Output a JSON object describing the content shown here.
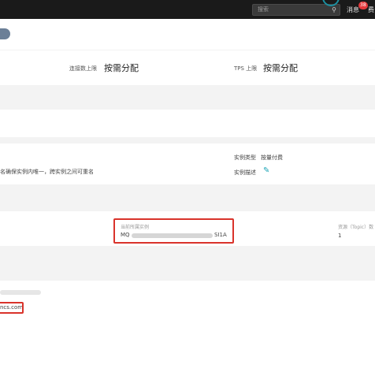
{
  "topbar": {
    "search_placeholder": "搜索",
    "search_icon": "search-icon",
    "messages_label": "消息",
    "messages_badge": "38",
    "more_label": "费"
  },
  "capacity": {
    "connection_label": "连接数上限",
    "connection_value": "按需分配",
    "tps_label": "TPS 上限",
    "tps_value": "按需分配"
  },
  "instance": {
    "type_label": "实例类型",
    "type_value": "按量付费",
    "desc_label": "实例描述",
    "name_hint": "名确保实例内唯一，跨实例之间可重名",
    "edit_icon": "edit-icon"
  },
  "summary": {
    "instance_id_label": "当前所属实例",
    "instance_id_prefix": "MQ",
    "instance_id_suffix": "SI1A",
    "topic_count_label": "资源（Topic）数",
    "topic_count_value": "1"
  },
  "endpoint": {
    "domain_suffix": "ncs.com"
  },
  "colors": {
    "accent": "#1aa3b5",
    "highlight": "#d9332b",
    "topbar": "#1a1a1a"
  }
}
